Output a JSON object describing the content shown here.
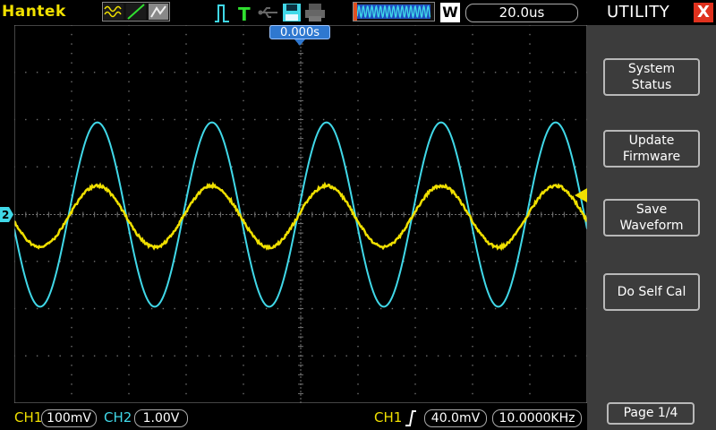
{
  "brand": "Hantek",
  "timebase": "20.0us",
  "window_label": "W",
  "trigger_position": "0.000s",
  "channel2_marker": "2",
  "menu": {
    "title": "UTILITY",
    "close": "X",
    "buttons": [
      {
        "line1": "System",
        "line2": "Status"
      },
      {
        "line1": "Update",
        "line2": "Firmware"
      },
      {
        "line1": "Save",
        "line2": "Waveform"
      },
      {
        "line1": "Do Self Cal",
        "line2": ""
      }
    ],
    "page": "Page 1/4"
  },
  "status": {
    "ch1_label": "CH1",
    "ch1_scale": "100mV",
    "ch2_label": "CH2",
    "ch2_scale": "1.00V",
    "trigger_source": "CH1",
    "trigger_level": "40.0mV",
    "frequency": "10.0000KHz"
  },
  "colors": {
    "ch1": "#f0e000",
    "ch2": "#40d8e8",
    "grid": "#707070",
    "accent": "#2f78d0"
  },
  "icons": {
    "waveform_modes": [
      "sine-wave-icon",
      "ramp-icon",
      "persistence-icon"
    ],
    "run": "pulse-run-icon",
    "trigger": "trigger-t-icon",
    "usb": "usb-icon",
    "save": "floppy-disk-icon",
    "print": "printer-icon",
    "window": "waveform-window-icon",
    "trigger_edge": "rising-edge-icon",
    "trigger_level": "trigger-level-arrow-icon"
  },
  "trace": {
    "ch2_amplitude_div": 1.95,
    "ch1_amplitude_div": 0.65,
    "ch1_offset_div": -0.04,
    "period_div": 2.0,
    "phase_div": 0.95
  }
}
